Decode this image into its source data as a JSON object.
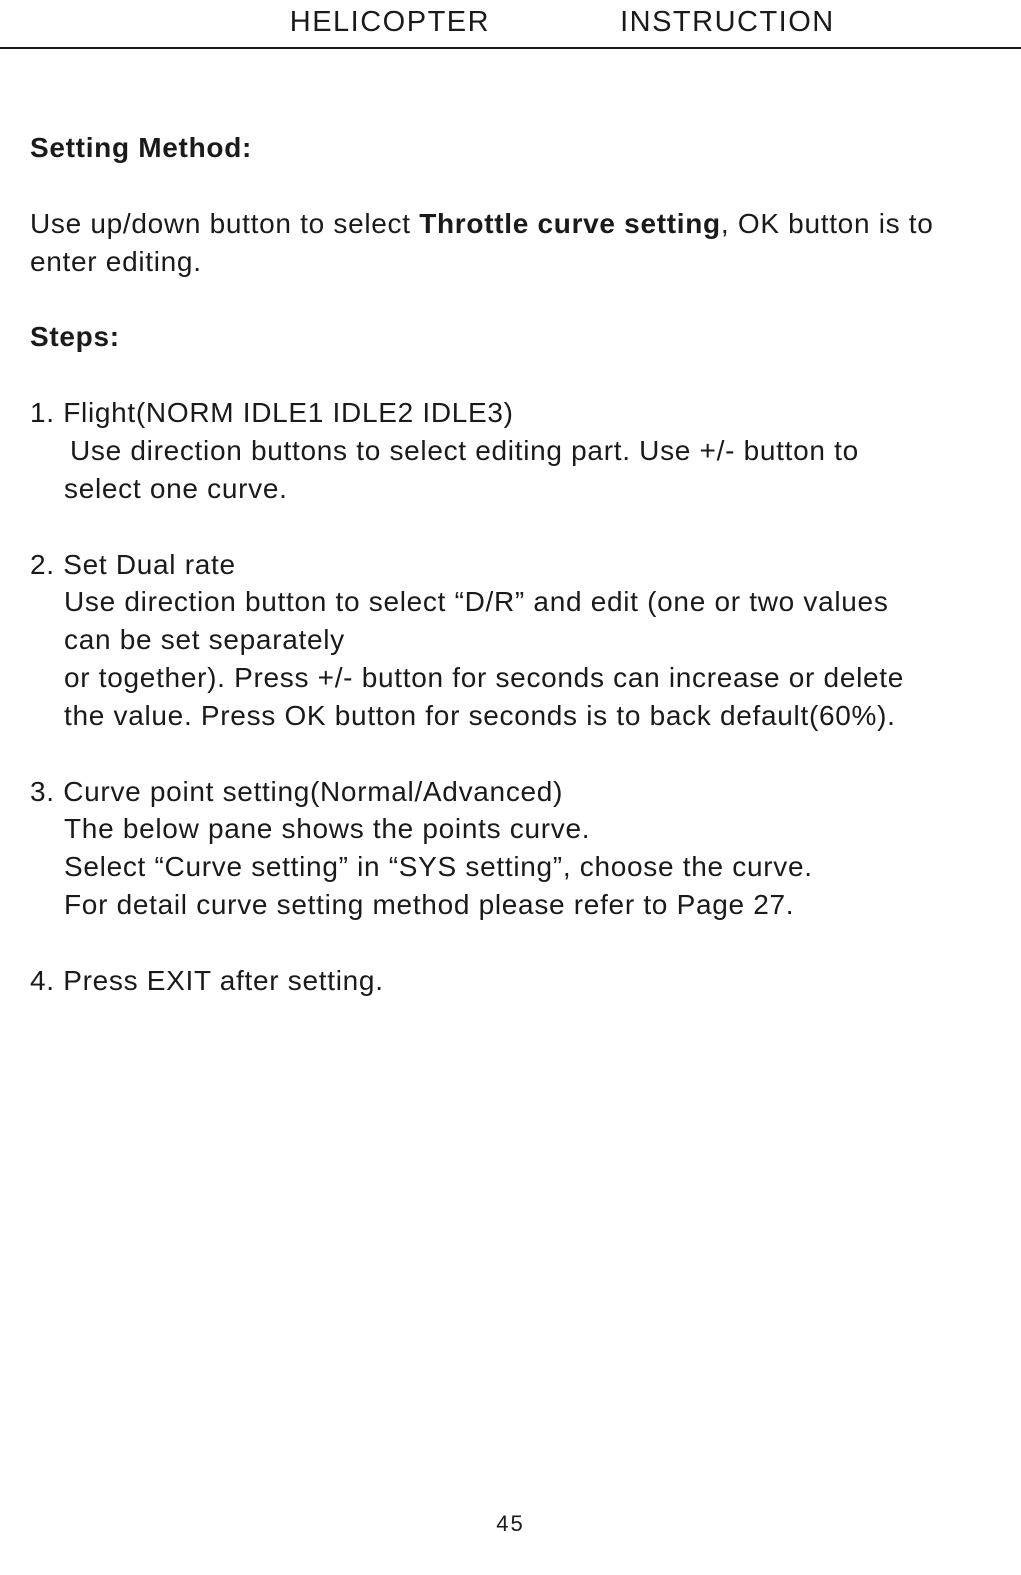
{
  "header": {
    "left": "HELICOPTER",
    "right": "INSTRUCTION"
  },
  "body": {
    "setting_method_title": "Setting Method:",
    "intro_pre": "Use up/down button to select ",
    "intro_bold": "Throttle curve setting",
    "intro_post": ", OK button is to enter editing.",
    "steps_title": "Steps:",
    "step1_line1": "1. Flight(NORM IDLE1 IDLE2 IDLE3)",
    "step1_body_line1": "Use direction buttons to select editing part. Use +/- button to",
    "step1_body_line2": "select one curve.",
    "step2_line1": "2. Set Dual rate",
    "step2_body_line1": "Use direction button to select “D/R” and edit (one or two values",
    "step2_body_line2": "can be set separately",
    "step2_body_line3": "or together). Press +/- button for seconds can increase or delete",
    "step2_body_line4": "the value. Press OK button for seconds  is to back default(60%).",
    "step3_line1": "3. Curve point setting(Normal/Advanced)",
    "step3_body_line1": "The below pane shows the points curve.",
    "step3_body_line2": "Select “Curve setting” in “SYS setting”, choose the curve.",
    "step3_body_line3": "For detail curve setting method please refer to Page 27.",
    "step4_line1": "4. Press EXIT after setting."
  },
  "page_number": "45"
}
